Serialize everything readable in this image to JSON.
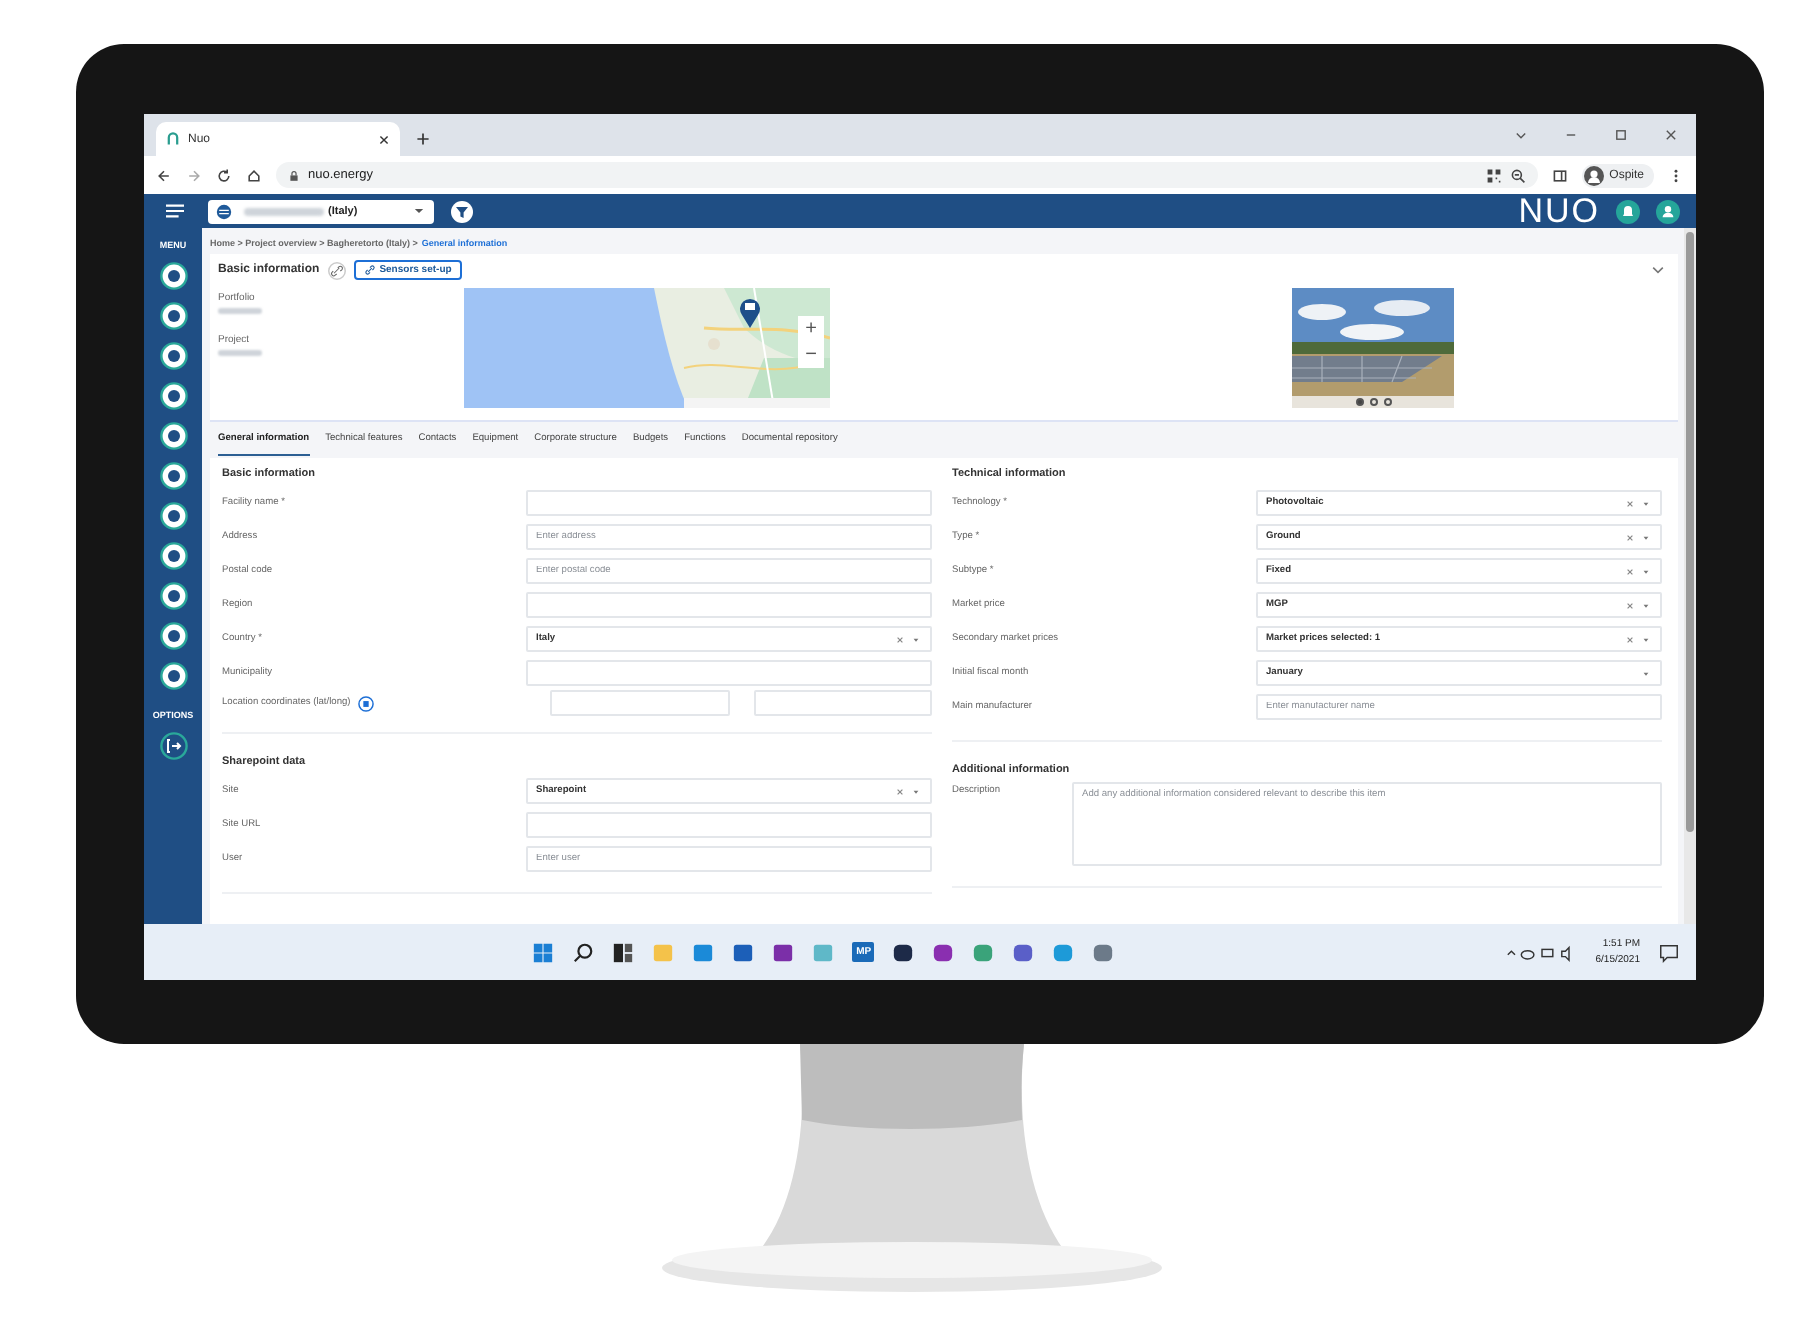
{
  "browser": {
    "tab_title": "Nuo",
    "url": "nuo.energy",
    "profile": "Ospite"
  },
  "app_header": {
    "project_select": "(Italy)",
    "logo": "NUO"
  },
  "sidebar": {
    "menu_label": "MENU",
    "options_label": "OPTIONS"
  },
  "breadcrumb": {
    "path": "Home > Project overview > Bagheretorto (Italy) >",
    "current": "General information"
  },
  "basic_panel": {
    "title": "Basic information",
    "sensors_button": "Sensors set-up",
    "labels": [
      "Portfolio",
      "Project"
    ],
    "map_zoom": [
      "+",
      "−"
    ],
    "carousel_dots": [
      {
        "selected": true
      },
      {
        "selected": false
      },
      {
        "selected": false
      }
    ]
  },
  "tabs": [
    {
      "label": "General information",
      "selected": true
    },
    {
      "label": "Technical features",
      "selected": false
    },
    {
      "label": "Contacts",
      "selected": false
    },
    {
      "label": "Equipment",
      "selected": false
    },
    {
      "label": "Corporate structure",
      "selected": false
    },
    {
      "label": "Budgets",
      "selected": false
    },
    {
      "label": "Functions",
      "selected": false
    },
    {
      "label": "Documental repository",
      "selected": false
    }
  ],
  "left_sections": [
    {
      "title": "Basic information",
      "fields": [
        {
          "kind": "text",
          "label": "Facility name *"
        },
        {
          "kind": "text",
          "label": "Address",
          "placeholder": "Enter address"
        },
        {
          "kind": "text",
          "label": "Postal code",
          "placeholder": "Enter postal code"
        },
        {
          "kind": "text",
          "label": "Region"
        },
        {
          "kind": "select",
          "label": "Country *",
          "value": "Italy",
          "clearable": true
        },
        {
          "kind": "text",
          "label": "Municipality"
        },
        {
          "kind": "coords",
          "label": "Location coordinates (lat/long)"
        }
      ]
    },
    {
      "title": "Sharepoint data",
      "fields": [
        {
          "kind": "select",
          "label": "Site",
          "value": "Sharepoint",
          "clearable": true
        },
        {
          "kind": "text",
          "label": "Site URL"
        },
        {
          "kind": "text",
          "label": "User",
          "placeholder": "Enter user"
        }
      ]
    }
  ],
  "right_sections": [
    {
      "title": "Technical information",
      "fields": [
        {
          "kind": "select",
          "label": "Technology *",
          "value": "Photovoltaic",
          "clearable": true
        },
        {
          "kind": "select",
          "label": "Type *",
          "value": "Ground",
          "clearable": true
        },
        {
          "kind": "select",
          "label": "Subtype *",
          "value": "Fixed",
          "clearable": true
        },
        {
          "kind": "select",
          "label": "Market price",
          "value": "MGP",
          "clearable": true
        },
        {
          "kind": "select",
          "label": "Secondary market prices",
          "value": "Market prices selected: 1",
          "clearable": true
        },
        {
          "kind": "select",
          "label": "Initial fiscal month",
          "value": "January",
          "clearable": false
        },
        {
          "kind": "text",
          "label": "Main manufacturer",
          "placeholder": "Enter manufacturer name"
        }
      ]
    },
    {
      "title": "Additional information",
      "fields": [
        {
          "kind": "textarea",
          "label": "Description",
          "placeholder": "Add any additional information considered relevant to describe this item"
        }
      ]
    }
  ],
  "taskbar": {
    "app_label": "MP",
    "time": "1:51 PM",
    "date": "6/15/2021"
  }
}
